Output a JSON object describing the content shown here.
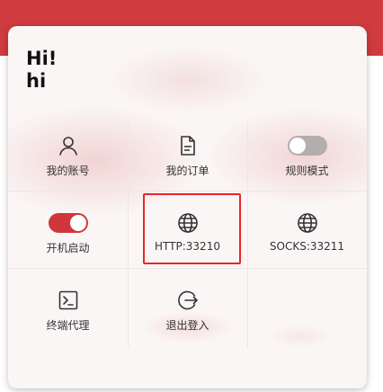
{
  "greeting": {
    "line1": "Hi!",
    "line2": "hi"
  },
  "menu": {
    "account": {
      "label": "我的账号",
      "icon": "user-icon"
    },
    "orders": {
      "label": "我的订单",
      "icon": "document-icon"
    },
    "rule_mode": {
      "label": "规则模式",
      "icon": "toggle",
      "enabled": false
    },
    "auto_start": {
      "label": "开机启动",
      "icon": "toggle",
      "enabled": true
    },
    "http": {
      "label": "HTTP:33210",
      "icon": "globe-icon"
    },
    "socks": {
      "label": "SOCKS:33211",
      "icon": "globe-icon"
    },
    "terminal_proxy": {
      "label": "终端代理",
      "icon": "terminal-icon"
    },
    "logout": {
      "label": "退出登入",
      "icon": "logout-icon"
    }
  },
  "colors": {
    "header": "#cf3b3f",
    "toggle_on": "#d0373c",
    "toggle_off": "#b4adad",
    "highlight": "#e8262a"
  }
}
